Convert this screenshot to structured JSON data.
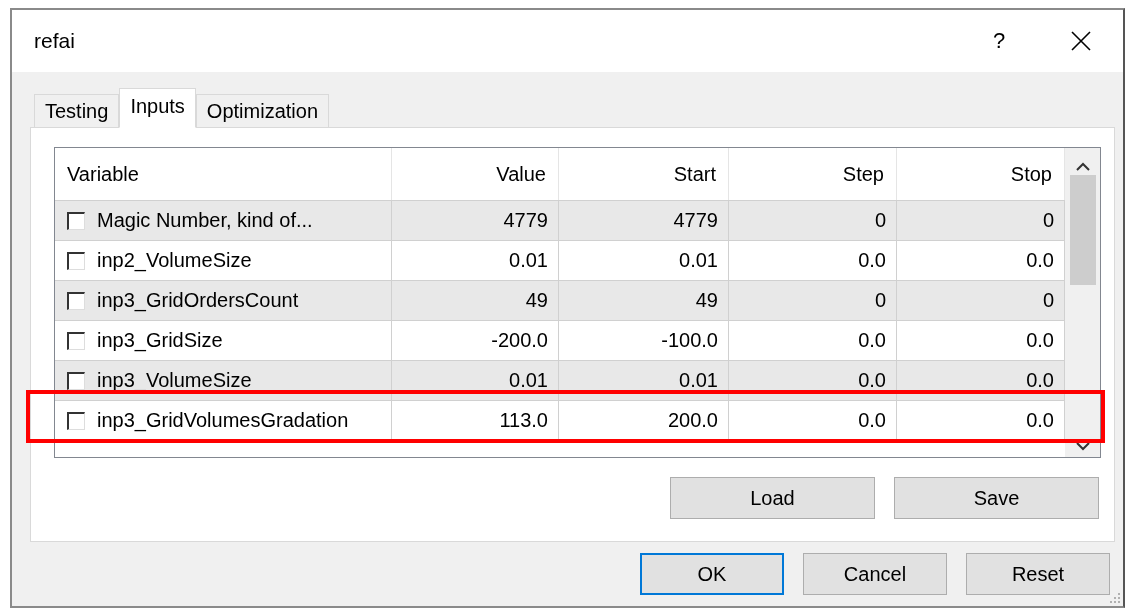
{
  "window": {
    "title": "refai",
    "help": "?"
  },
  "tabs": [
    {
      "label": "Testing",
      "selected": false
    },
    {
      "label": "Inputs",
      "selected": true
    },
    {
      "label": "Optimization",
      "selected": false
    }
  ],
  "table": {
    "columns": [
      "Variable",
      "Value",
      "Start",
      "Step",
      "Stop"
    ],
    "rows": [
      {
        "checked": false,
        "highlighted": false,
        "cells": [
          "Magic Number, kind of...",
          "4779",
          "4779",
          "0",
          "0"
        ]
      },
      {
        "checked": false,
        "highlighted": false,
        "cells": [
          "inp2_VolumeSize",
          "0.01",
          "0.01",
          "0.0",
          "0.0"
        ]
      },
      {
        "checked": false,
        "highlighted": false,
        "cells": [
          "inp3_GridOrdersCount",
          "49",
          "49",
          "0",
          "0"
        ]
      },
      {
        "checked": false,
        "highlighted": false,
        "cells": [
          "inp3_GridSize",
          "-200.0",
          "-100.0",
          "0.0",
          "0.0"
        ]
      },
      {
        "checked": false,
        "highlighted": false,
        "cells": [
          "inp3_VolumeSize",
          "0.01",
          "0.01",
          "0.0",
          "0.0"
        ]
      },
      {
        "checked": false,
        "highlighted": true,
        "cells": [
          "inp3_GridVolumesGradation",
          "113.0",
          "200.0",
          "0.0",
          "0.0"
        ]
      }
    ]
  },
  "panel_buttons": [
    "Load",
    "Save"
  ],
  "footer_buttons": [
    {
      "label": "OK",
      "focused": true
    },
    {
      "label": "Cancel",
      "focused": false
    },
    {
      "label": "Reset",
      "focused": false
    }
  ]
}
